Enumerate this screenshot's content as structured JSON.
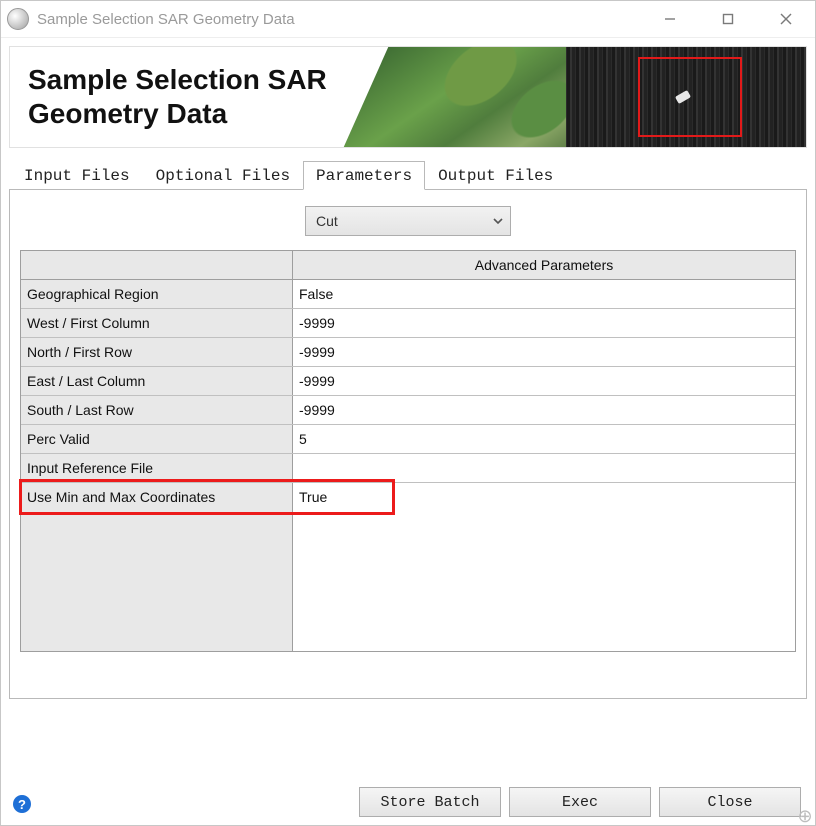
{
  "window": {
    "title": "Sample Selection SAR Geometry Data"
  },
  "header": {
    "title_line1": "Sample Selection SAR",
    "title_line2": "Geometry Data"
  },
  "tabs": [
    {
      "label": "Input Files",
      "active": false
    },
    {
      "label": "Optional Files",
      "active": false
    },
    {
      "label": "Parameters",
      "active": true
    },
    {
      "label": "Output Files",
      "active": false
    }
  ],
  "dropdown": {
    "value": "Cut"
  },
  "param_table": {
    "header": "Advanced Parameters",
    "rows": [
      {
        "label": "Geographical Region",
        "value": "False"
      },
      {
        "label": "West / First Column",
        "value": "-9999"
      },
      {
        "label": "North / First Row",
        "value": "-9999"
      },
      {
        "label": "East / Last Column",
        "value": "-9999"
      },
      {
        "label": "South / Last Row",
        "value": "-9999"
      },
      {
        "label": "Perc Valid",
        "value": "5"
      },
      {
        "label": "Input Reference File",
        "value": ""
      },
      {
        "label": "Use Min and Max Coordinates",
        "value": "True"
      }
    ]
  },
  "buttons": {
    "store_batch": "Store Batch",
    "exec": "Exec",
    "close": "Close"
  },
  "help_glyph": "?",
  "plus_glyph": "⊕"
}
